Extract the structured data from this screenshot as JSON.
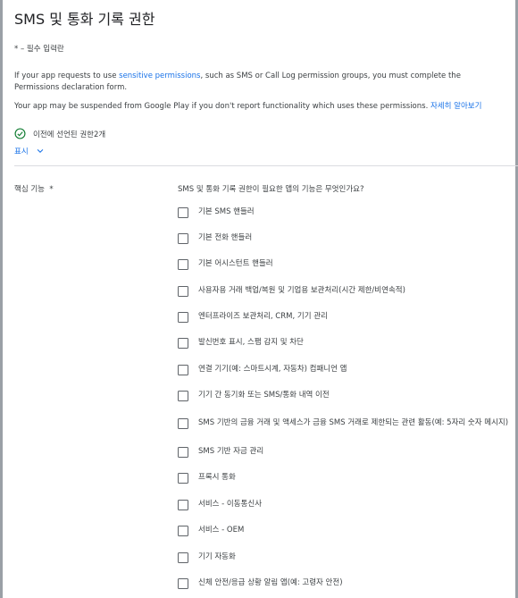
{
  "page": {
    "title": "SMS 및 통화 기록 권한",
    "required_note": "* – 필수 입력란",
    "para1_before": "If your app requests to use ",
    "para1_link": "sensitive permissions",
    "para1_after": ", such as SMS or Call Log permission groups, you must complete the Permissions declaration form.",
    "para2_text": "Your app may be suspended from Google Play if you don't report functionality which uses these permissions. ",
    "para2_link": "자세히 알아보기",
    "declared_text": "이전에 선언된 권한 ",
    "declared_count": "2개",
    "show_label": "표시",
    "feature_label": "핵심 기능",
    "feature_required": "*",
    "question": "SMS 및 통화 기록 권한이 필요한 앱의 기능은 무엇인가요?"
  },
  "options": [
    "기본 SMS 핸들러",
    "기본 전화 핸들러",
    "기본 어시스턴트 핸들러",
    "사용자용 거래 백업/복원 및 기업용 보관처리(시간 제한/비연속적)",
    "엔터프라이즈 보관처리, CRM, 기기 관리",
    "발신번호 표시, 스팸 감지 및 차단",
    "연결 기기(예: 스마트시계, 자동차) 컴패니언 앱",
    "기기 간 동기화 또는 SMS/통화 내역 이전",
    "SMS 기반의 금융 거래 및 액세스가 금융 SMS 거래로 제한되는 관련 활동(예: 5자리 숫자 메시지)",
    "SMS 기반 자금 관리",
    "프록시 통화",
    "서비스 - 이동통신사",
    "서비스 - OEM",
    "기기 자동화",
    "신체 안전/응급 상황 알림 앱(예: 고령자 안전)"
  ],
  "colors": {
    "link": "#1a73e8",
    "success": "#188038",
    "text": "#3c4043"
  }
}
